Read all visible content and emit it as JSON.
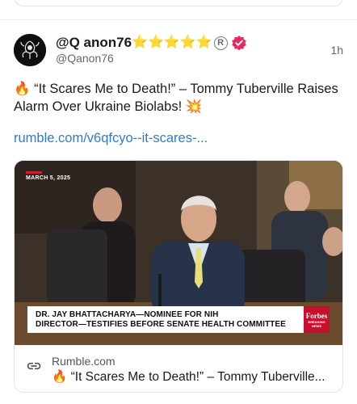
{
  "post": {
    "display_name": "@Q anon76",
    "badge_stars": [
      "⭐",
      "⭐",
      "⭐",
      "⭐",
      "⭐"
    ],
    "registered_mark": "R",
    "handle": "@Qanon76",
    "time": "1h",
    "text": "🔥 “It Scares Me to Death!” – Tommy Tuberville Raises Alarm Over Ukraine Biolabs! 💥",
    "link_text": "rumble.com/v6qfcyo--it-scares-..."
  },
  "embed": {
    "date_label": "MARCH 5, 2025",
    "lower_third_line1": "DR. JAY BHATTACHARYA—NOMINEE FOR NIH",
    "lower_third_line2": "DIRECTOR—TESTIFIES BEFORE SENATE HEALTH COMMITTEE",
    "logo_text": "Forbes",
    "logo_sub": "BREAKING NEWS",
    "domain": "Rumble.com",
    "title": "🔥 “It Scares Me to Death!” – Tommy Tuberville..."
  },
  "colors": {
    "link": "#2b7bd6",
    "star": "#f5c518",
    "verified": "#e6295f",
    "accent_red": "#c8102e"
  },
  "icons": {
    "avatar": "avatar-image",
    "verified": "verified-badge-icon",
    "link": "link-chain-icon"
  }
}
